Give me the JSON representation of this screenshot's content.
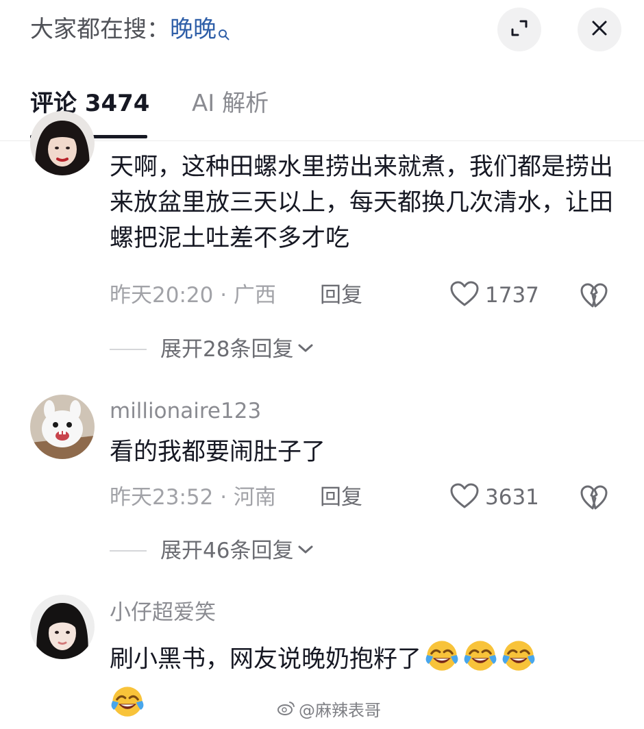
{
  "header": {
    "search_prefix": "大家都在搜：",
    "search_keyword": "晚晚"
  },
  "tabs": [
    {
      "label": "评论 3474"
    },
    {
      "label": "AI 解析"
    }
  ],
  "comments": [
    {
      "text": "天啊，这种田螺水里捞出来就煮，我们都是捞出来放盆里放三天以上，每天都换几次清水，让田螺把泥土吐差不多才吃",
      "time_location": "昨天20:20 · 广西",
      "reply_label": "回复",
      "likes": "1737",
      "expand_label": "展开28条回复"
    },
    {
      "username": "millionaire123",
      "text": "看的我都要闹肚子了",
      "time_location": "昨天23:52 · 河南",
      "reply_label": "回复",
      "likes": "3631",
      "expand_label": "展开46条回复"
    },
    {
      "username": "小仔超爱笑",
      "text": "刷小黑书，网友说晚奶抱籽了",
      "emoji": "laughing-crying-emoji"
    }
  ],
  "watermark": "@麻辣表哥"
}
